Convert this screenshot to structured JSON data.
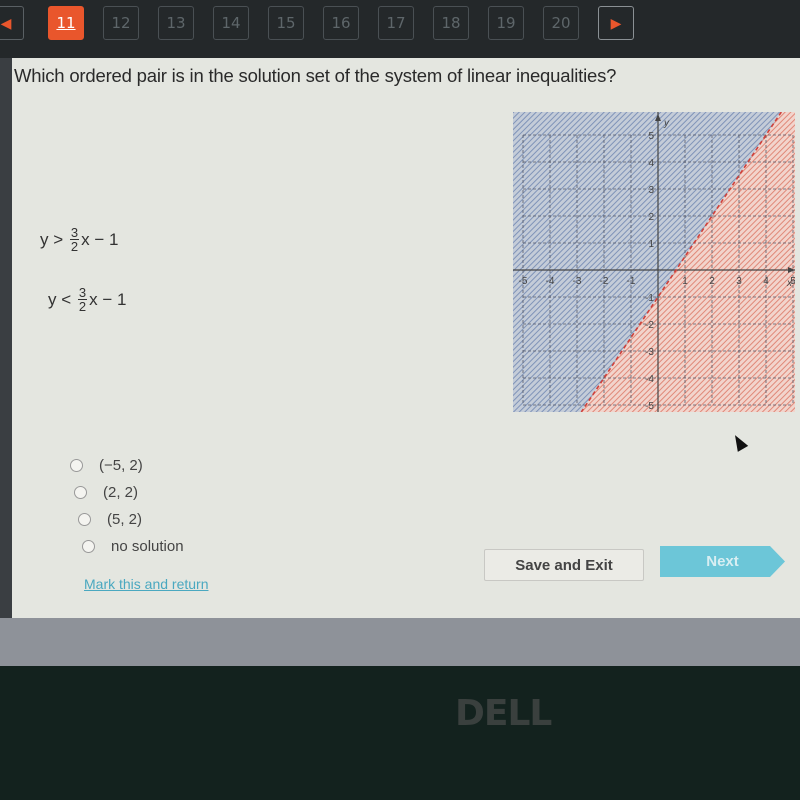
{
  "nav": {
    "prev_icon": "◀",
    "next_icon": "▶",
    "questions": [
      "11",
      "12",
      "13",
      "14",
      "15",
      "16",
      "17",
      "18",
      "19",
      "20"
    ],
    "active": "11"
  },
  "question": {
    "text": "Which ordered pair is in the solution set of the system of linear inequalities?",
    "inequalities": [
      {
        "lhs": "y",
        "op": ">",
        "num": "3",
        "den": "2",
        "rest": "x − 1"
      },
      {
        "lhs": "y",
        "op": "<",
        "num": "3",
        "den": "2",
        "rest": "x − 1"
      }
    ]
  },
  "graph": {
    "x_label": "x",
    "y_label": "y",
    "x_ticks": [
      "-5",
      "-4",
      "-3",
      "-2",
      "-1",
      "1",
      "2",
      "3",
      "4",
      "5"
    ],
    "y_ticks": [
      "5",
      "4",
      "3",
      "2",
      "1",
      "-1",
      "-2",
      "-3",
      "-4",
      "-5"
    ],
    "x_range": [
      -5,
      5
    ],
    "y_range": [
      -5,
      5
    ],
    "line": {
      "slope": 1.5,
      "intercept": -1,
      "style": "dashed"
    },
    "colors": {
      "blue_region": "#7f93b8",
      "red_region": "#e08878",
      "line": "#d0403a",
      "grid": "#555a6a"
    }
  },
  "choices": [
    {
      "label": "(−5, 2)"
    },
    {
      "label": "(2, 2)"
    },
    {
      "label": "(5, 2)"
    },
    {
      "label": "no solution"
    }
  ],
  "footer": {
    "mark_link": "Mark this and return",
    "save_label": "Save and Exit",
    "next_label": "Next"
  },
  "device": {
    "brand": "DELL"
  },
  "colors": {
    "accent": "#e9562c",
    "next_button": "#6cc6d8",
    "link": "#4aa8c0"
  }
}
